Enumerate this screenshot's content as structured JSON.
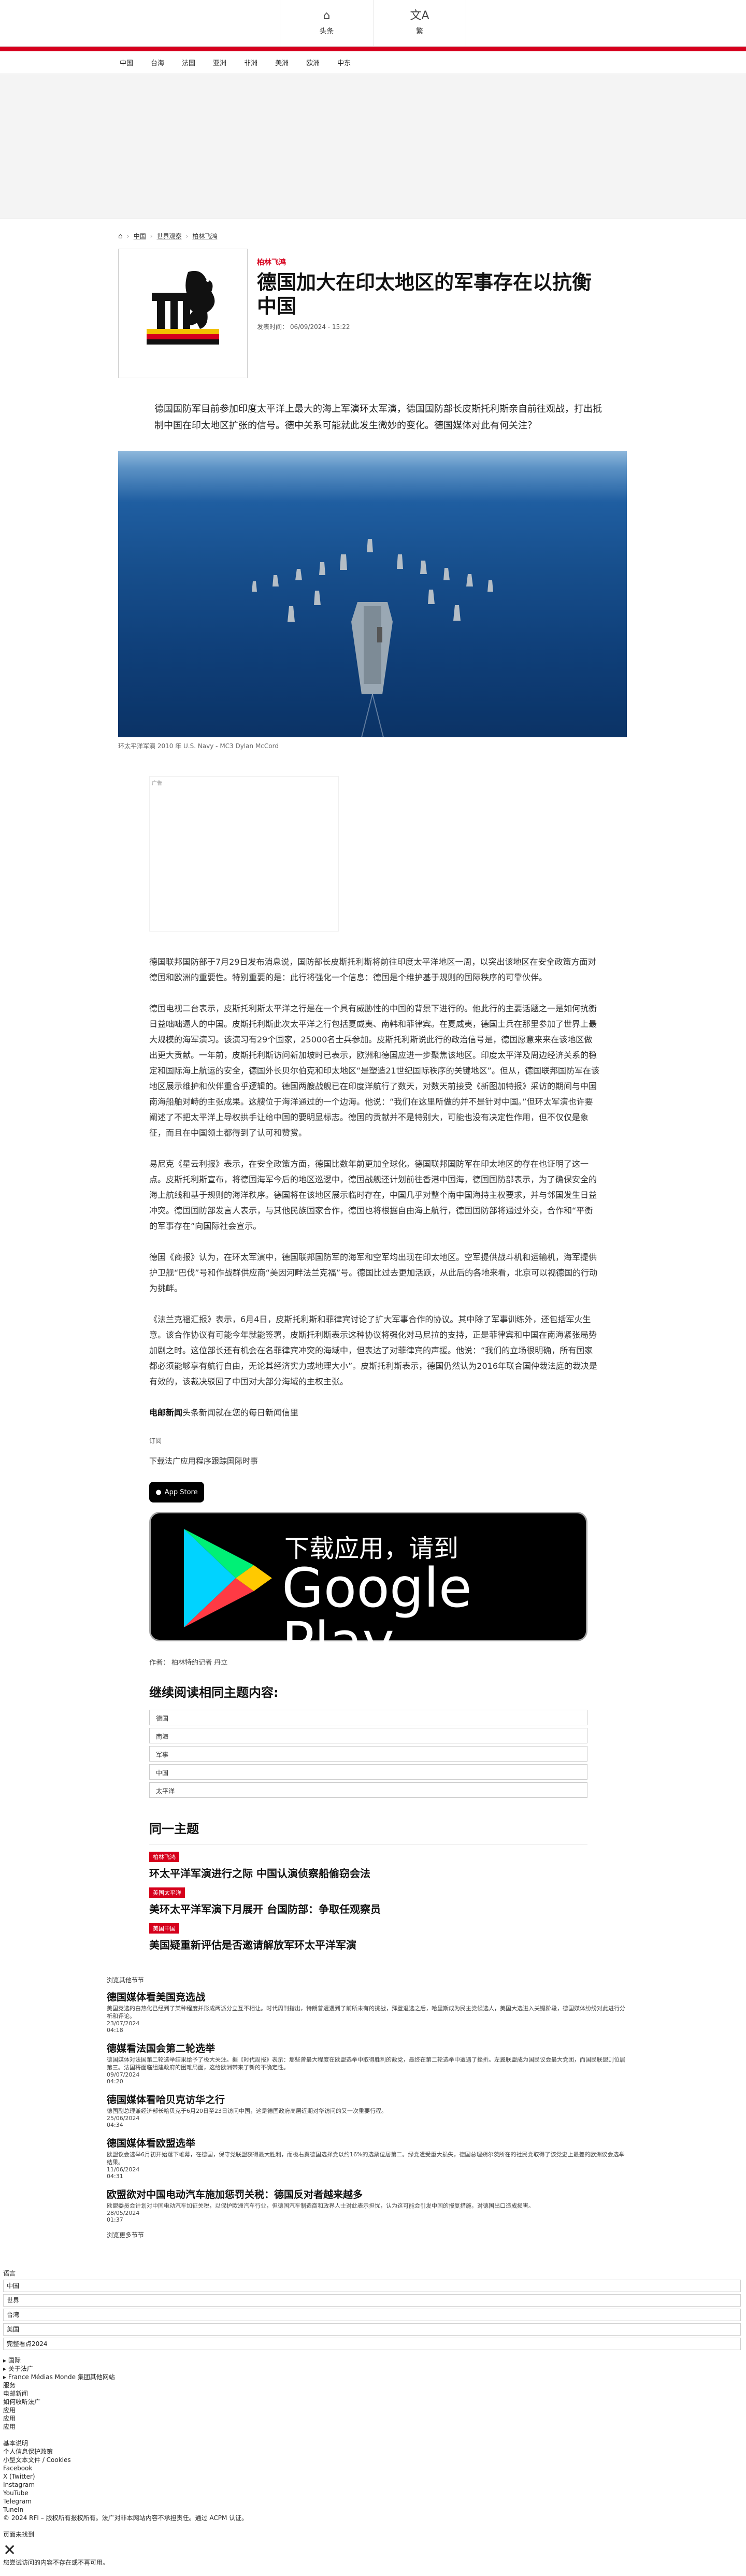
{
  "header": {
    "tabs": [
      {
        "label": "头条",
        "icon": "home-icon",
        "glyph": "⌂"
      },
      {
        "label": "繁",
        "icon": "translate-icon",
        "glyph": "文A"
      }
    ],
    "nav": [
      "中国",
      "台海",
      "法国",
      "亚洲",
      "非洲",
      "美洲",
      "欧洲",
      "中东"
    ]
  },
  "breadcrumb": {
    "home": "⌂",
    "items": [
      "中国",
      "世界观察",
      "柏林飞鸿"
    ]
  },
  "article": {
    "kicker": "柏林飞鸿",
    "title": "德国加大在印太地区的军事存在以抗衡中国",
    "published": "发表时间： 06/09/2024 - 15:22",
    "lead": "德国国防军目前参加印度太平洋上最大的海上军演环太军演，德国国防部长皮斯托利斯亲自前往观战，打出抵制中国在印太地区扩张的信号。德中关系可能就此发生微妙的变化。德国媒体对此有何关注？",
    "caption": "环太平洋军演 2010 年 U.S. Navy - MC3 Dylan McCord",
    "ad_label": "广告",
    "paragraphs": [
      "德国联邦国防部于7月29日发布消息说，国防部长皮斯托利斯将前往印度太平洋地区一周，以突出该地区在安全政策方面对德国和欧洲的重要性。特别重要的是：此行将强化一个信息：德国是个维护基于规则的国际秩序的可靠伙伴。",
      "德国电视二台表示，皮斯托利斯太平洋之行是在一个具有威胁性的中国的背景下进行的。他此行的主要话题之一是如何抗衡日益咄咄逼人的中国。皮斯托利斯此次太平洋之行包括夏威夷、南韩和菲律宾。在夏威夷，德国士兵在那里参加了世界上最大规模的海军演习。该演习有29个国家，25000名士兵参加。皮斯托利斯说此行的政治信号是，德国愿意来来在该地区做出更大贡献。一年前，皮斯托利斯访问新加坡时已表示，欧洲和德国应进一步聚焦该地区。印度太平洋及周边经济关系的稳定和国际海上航运的安全，德国外长贝尔伯克和印太地区“是塑造21世纪国际秩序的关键地区”。但从，德国联邦国防军在该地区展示维护和伙伴重合乎逻辑的。德国两艘战舰已在印度洋航行了数天，对数天前接受《新图加特报》采访的期间与中国南海船舶对峙的主张成果。这艘位于海洋通过的一个边海。他说：“我们在这里所做的并不是针对中国。”但环太军演也许要阐述了不把太平洋上导权拱手让给中国的要明显标志。德国的贡献并不是特别大，可能也没有决定性作用，但不仅仅是象征，而且在中国领土都得到了认可和赞赏。",
      "易尼克《星云利报》表示，在安全政策方面，德国比数年前更加全球化。德国联邦国防军在印太地区的存在也证明了这一点。皮斯托利斯宣布，将德国海军今后的地区巡逻中，德国战舰还计划前往香港中国海，德国国防部表示，为了确保安全的海上航线和基于规则的海洋秩序。德国将在该地区展示临时存在，中国几乎对整个南中国海持主权要求，并与邻国发生日益冲突。德国国防部发言人表示，与其他民族国家合作，德国也将根据自由海上航行，德国国防部将通过外交，合作和“平衡的军事存在”向国际社会宣示。",
      "德国《商报》认为，在环太军演中，德国联邦国防军的海军和空军均出现在印太地区。空军提供战斗机和运输机，海军提供护卫舰“巴伐”号和作战群供应商“美因河畔法兰克福”号。德国比过去更加活跃，从此后的各地来看，北京可以视德国的行动为挑衅。",
      "《法兰克福汇报》表示，6月4日，皮斯托利斯和菲律宾讨论了扩大军事合作的协议。其中除了军事训练外，还包括军火生意。该合作协议有可能今年就能签署，皮斯托利斯表示这种协议将强化对马尼拉的支持，正是菲律宾和中国在南海紧张局势加剧之时。这位部长还有机会在名菲律宾冲突的海域中，但表达了对菲律宾的声援。他说：“我们的立场很明确，所有国家都必须能够享有航行自由，无论其经济实力或地理大小”。皮斯托利斯表示，德国仍然认为2016年联合国仲裁法庭的裁决是有效的，该裁决驳回了中国对大部分海域的主权主张。"
    ],
    "subscribe_bold": "电邮新闻",
    "subscribe_rest": "头条新闻就在您的每日新闻信里",
    "subscribe_label": "订阅",
    "download_text": "下载法广应用程序跟踪国际时事",
    "appstore": "App Store",
    "gplay_line1": "下载应用，请到",
    "gplay_line2": "Google Play",
    "author": "作者：  柏林特约记者 丹立"
  },
  "continue_reading": {
    "title": "继续阅读相同主题内容:",
    "tags": [
      "德国",
      "南海",
      "军事",
      "中国",
      "太平洋"
    ]
  },
  "same_topic": {
    "title": "同一主题",
    "items": [
      {
        "badge": "柏林飞鸿",
        "title": "环太平洋军演进行之际 中国认演侦察船偷窃会法"
      },
      {
        "badge": "美国太平洋",
        "title": "美环太平洋军演下月展开 台国防部：争取任观察员"
      },
      {
        "badge": "美国中国",
        "title": "美国疑重新评估是否邀请解放军环太平洋军演"
      }
    ]
  },
  "latest": {
    "head": "浏览其他节节",
    "items": [
      {
        "title": "德国媒体看美国竞选战",
        "desc": "美国竞选的白热化已经到了某种程度并形成两派分立互不相让。时代周刊指出，特朗普遭遇到了前所未有的挑战，拜登退选之后，哈里斯成为民主党候选人，美国大选进入关键阶段，德国媒体纷纷对此进行分析和评论。",
        "ts": "23/07/2024\n04:18"
      },
      {
        "title": "德媒看法国会第二轮选举",
        "desc": "德国媒体对法国第二轮选举结果给予了极大关注。据《时代周报》表示：那些曾最大程度在欧盟选举中取得胜利的政党，最终在第二轮选举中遭遇了挫折。左翼联盟成为国民议会最大党团，而国民联盟则位居第三。法国将面临组建政府的困难局面，这给欧洲带来了新的不确定性。",
        "ts": "09/07/2024\n04:20"
      },
      {
        "title": "德国媒体看哈贝克访华之行",
        "desc": "德国副总理兼经济部长哈贝克于6月20日至23日访问中国，这是德国政府高层近期对华访问的又一次重要行程。",
        "ts": "25/06/2024\n04:34"
      },
      {
        "title": "德国媒体看欧盟选举",
        "desc": "欧盟议会选举6月初开始落下帷幕，在德国，保守党联盟获得最大胜利，而极右翼德国选择党以约16%的选票位居第二。绿党遭受重大损失，德国总理朔尔茨所在的社民党取得了该党史上最差的欧洲议会选举结果。",
        "ts": "11/06/2024\n04:31"
      },
      {
        "title": "欧盟欲对中国电动汽车施加惩罚关税：德国反对者越来越多",
        "desc": "欧盟委员会计划对中国电动汽车加征关税，以保护欧洲汽车行业，但德国汽车制造商和政界人士对此表示担忧，认为这可能会引发中国的报复措施，对德国出口造成损害。",
        "ts": "28/05/2024\n01:37"
      }
    ],
    "more": "浏览更多节节"
  },
  "footer": {
    "language_label": "语言",
    "language_options": [
      "中国",
      "世界",
      "台湾",
      "美国"
    ],
    "archive_select": "完整看点2024",
    "lines": [
      "▸ 国际",
      "▸ 关于法广",
      "▸ France Médias Monde 集团其他网站",
      "服务",
      "电邮新闻",
      "如何收听法广",
      "应用",
      "应用",
      "应用",
      "",
      "基本说明",
      "个人信息保护政策",
      "小型文本文件 / Cookies",
      "Facebook",
      "X (Twitter)",
      "Instagram",
      "YouTube",
      "Telegram",
      "TuneIn",
      "© 2024 RFI – 版权所有报权所有。法广对非本网站内容不承担责任。通过 ACPM 认证。",
      "",
      "页面未找到",
      "✕",
      "您尝试访问的内容不存在或不再可用。"
    ]
  },
  "colors": {
    "accent": "#d6001c",
    "text": "#1a1a1a",
    "sea": "#174f8d"
  }
}
